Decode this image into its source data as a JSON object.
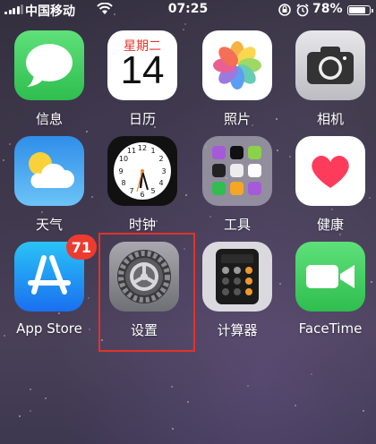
{
  "status_bar": {
    "carrier": "中国移动",
    "time": "07:25",
    "battery": "78%"
  },
  "apps": [
    {
      "id": "messages",
      "label": "信息",
      "icon": "messages-icon"
    },
    {
      "id": "calendar",
      "label": "日历",
      "icon": "calendar-icon",
      "weekday": "星期二",
      "day": "14"
    },
    {
      "id": "photos",
      "label": "照片",
      "icon": "photos-icon"
    },
    {
      "id": "camera",
      "label": "相机",
      "icon": "camera-icon"
    },
    {
      "id": "weather",
      "label": "天气",
      "icon": "weather-icon"
    },
    {
      "id": "clock",
      "label": "时钟",
      "icon": "clock-icon"
    },
    {
      "id": "utilities",
      "label": "工具",
      "icon": "folder-icon"
    },
    {
      "id": "health",
      "label": "健康",
      "icon": "health-icon"
    },
    {
      "id": "app-store",
      "label": "App Store",
      "icon": "app-store-icon",
      "badge": "71"
    },
    {
      "id": "settings",
      "label": "设置",
      "icon": "gear-icon",
      "highlighted": true
    },
    {
      "id": "calculator",
      "label": "计算器",
      "icon": "calculator-icon"
    },
    {
      "id": "facetime",
      "label": "FaceTime",
      "icon": "video-camera-icon"
    }
  ],
  "colors": {
    "messages": "#35c25a",
    "facetime": "#2fcf58",
    "app_store": "#1d8ff2",
    "weather": "#3a9ff0",
    "badge": "#ee3b30",
    "highlight": "#e0332a",
    "calendar_red": "#e5332a"
  }
}
